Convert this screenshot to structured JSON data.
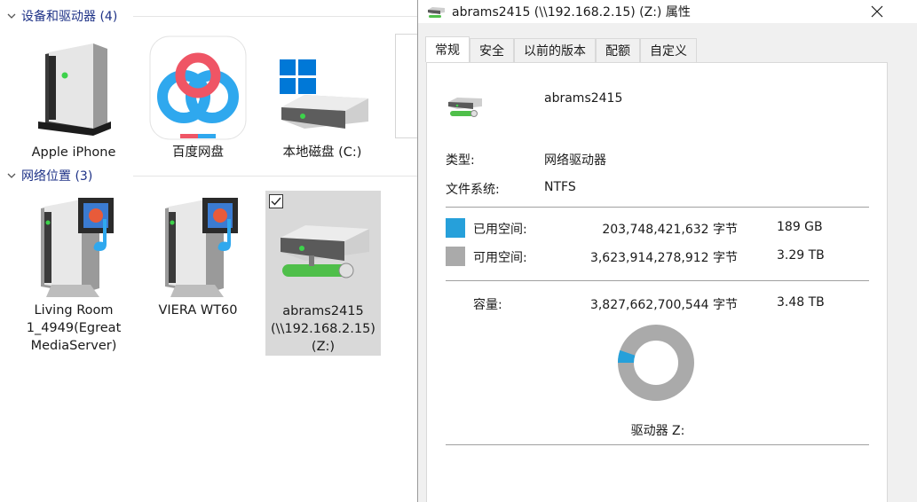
{
  "explorer": {
    "devices_group": {
      "label": "设备和驱动器 (4)"
    },
    "network_group": {
      "label": "网络位置 (3)"
    },
    "devices": [
      {
        "label": "Apple iPhone",
        "icon": "server-icon"
      },
      {
        "label": "百度网盘",
        "icon": "baidu-netdisk-icon"
      },
      {
        "label": "本地磁盘 (C:)",
        "icon": "local-disk-icon"
      }
    ],
    "network": [
      {
        "label": "Living Room\n1_4949(Egreat\nMediaServer)",
        "icon": "media-server-icon"
      },
      {
        "label": "VIERA WT60",
        "icon": "media-server-icon"
      },
      {
        "label": "abrams2415\n(\\\\192.168.2.15)\n(Z:)",
        "icon": "network-drive-icon",
        "selected": true
      }
    ]
  },
  "dialog": {
    "title": "abrams2415 (\\\\192.168.2.15) (Z:) 属性",
    "tabs": [
      "常规",
      "安全",
      "以前的版本",
      "配额",
      "自定义"
    ],
    "active_tab": "常规",
    "drive_name": "abrams2415",
    "type_label": "类型:",
    "type_value": "网络驱动器",
    "fs_label": "文件系统:",
    "fs_value": "NTFS",
    "used_label": "已用空间:",
    "used_bytes": "203,748,421,632 字节",
    "used_human": "189 GB",
    "free_label": "可用空间:",
    "free_bytes": "3,623,914,278,912 字节",
    "free_human": "3.29 TB",
    "capacity_label": "容量:",
    "capacity_bytes": "3,827,662,700,544 字节",
    "capacity_human": "3.48 TB",
    "drive_label": "驱动器 Z:",
    "used_fraction": 0.0532,
    "colors": {
      "used": "#26a0da",
      "free": "#aaaaaa"
    }
  }
}
